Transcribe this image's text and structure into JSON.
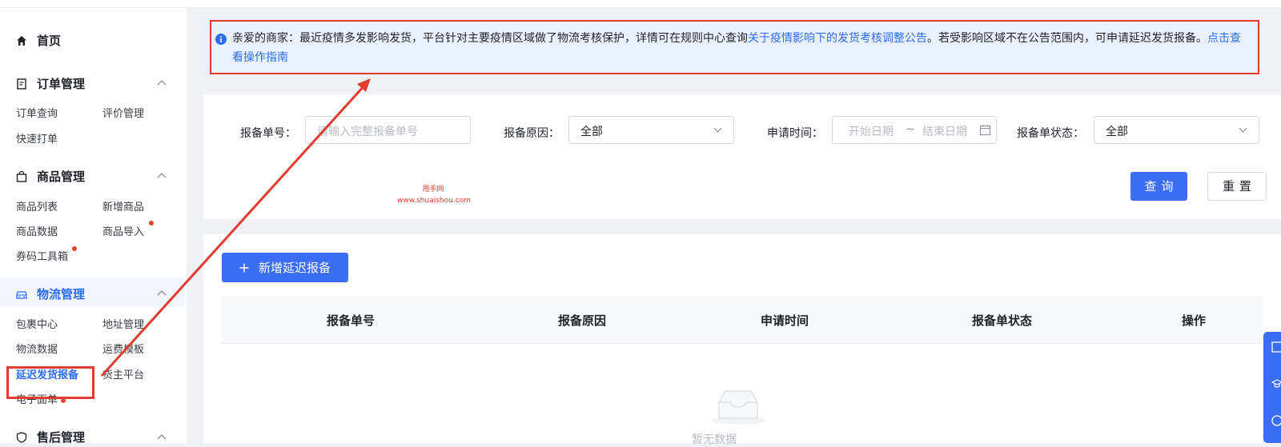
{
  "sidebar": {
    "home": "首页",
    "groups": [
      {
        "title": "订单管理",
        "items": [
          "订单查询",
          "评价管理",
          "快速打单"
        ]
      },
      {
        "title": "商品管理",
        "items": [
          "商品列表",
          "新增商品",
          "商品数据",
          "商品导入",
          "券码工具箱"
        ]
      },
      {
        "title": "物流管理",
        "items": [
          "包裹中心",
          "地址管理",
          "物流数据",
          "运费模板",
          "延迟发货报备",
          "货主平台",
          "电子面单"
        ]
      },
      {
        "title": "售后管理"
      }
    ]
  },
  "notice": {
    "text_before": "亲爱的商家：最近疫情多发影响发货，平台针对主要疫情区域做了物流考核保护，详情可在规则中心查询",
    "link1": "关于疫情影响下的发货考核调整公告",
    "text_middle": "。若受影响区域不在公告范围内，可申请延迟发货报备。",
    "link2": "点击查看操作指南"
  },
  "filters": {
    "report_no_label": "报备单号：",
    "report_no_placeholder": "请输入完整报备单号",
    "reason_label": "报备原因：",
    "reason_value": "全部",
    "time_label": "申请时间：",
    "start_placeholder": "开始日期",
    "range_sep": "~",
    "end_placeholder": "结束日期",
    "status_label": "报备单状态：",
    "status_value": "全部",
    "search_button": "查询",
    "reset_button": "重置"
  },
  "watermark": {
    "line1": "甩手网",
    "line2": "www.shuaishou.com"
  },
  "table": {
    "add_button": "新增延迟报备",
    "columns": [
      "报备单号",
      "报备原因",
      "申请时间",
      "报备单状态",
      "操作"
    ],
    "empty_text": "暂无数据"
  },
  "colors": {
    "accent": "#3b6ef5",
    "highlight": "#e03c30",
    "notice_bg": "#eaf1fe"
  }
}
